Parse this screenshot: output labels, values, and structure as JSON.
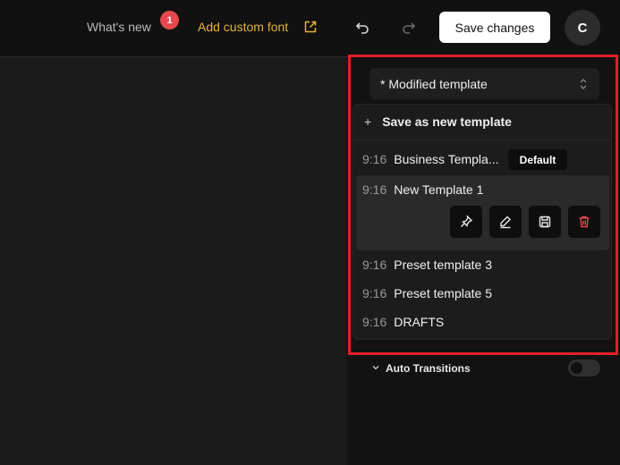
{
  "header": {
    "whats_new_label": "What's new",
    "whats_new_count": "1",
    "custom_font_label": "Add custom font",
    "save_label": "Save changes",
    "avatar_initial": "C"
  },
  "template_selector": {
    "current": "* Modified template"
  },
  "dropdown": {
    "save_as_new": "Save as new template",
    "plus": "+",
    "default_badge": "Default",
    "templates": [
      {
        "ratio": "9:16",
        "name": "Business Templa..."
      },
      {
        "ratio": "9:16",
        "name": "New Template 1"
      },
      {
        "ratio": "9:16",
        "name": "Preset template 3"
      },
      {
        "ratio": "9:16",
        "name": "Preset template 5"
      },
      {
        "ratio": "9:16",
        "name": "DRAFTS"
      }
    ],
    "actions": [
      "pin-icon",
      "edit-icon",
      "save-icon",
      "trash-icon"
    ]
  },
  "settings": {
    "auto_transitions_label": "Auto Transitions",
    "auto_transitions_enabled": false
  },
  "colors": {
    "accent_gold": "#e5b13a",
    "badge_red": "#e5484d",
    "highlight_red": "#e0202a",
    "delete_red": "#e5484d"
  }
}
